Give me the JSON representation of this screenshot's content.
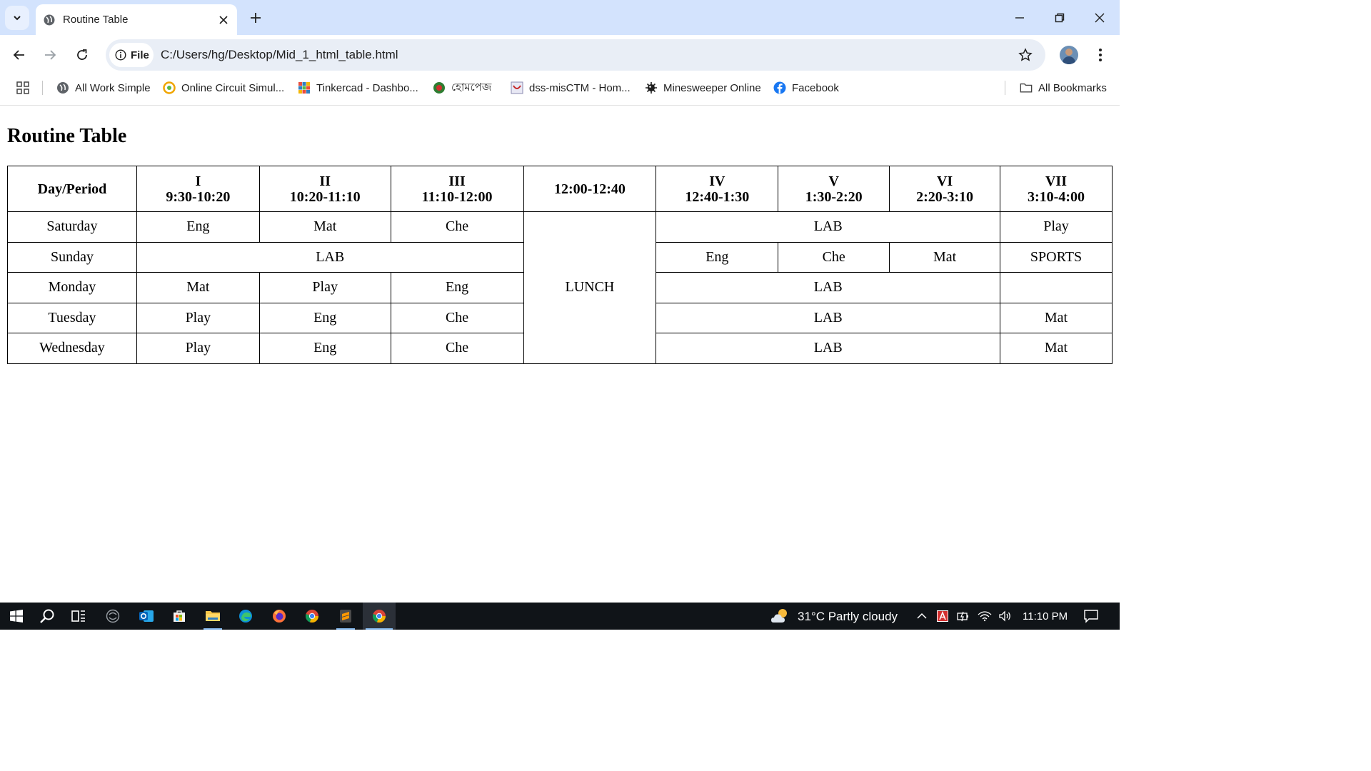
{
  "browser": {
    "tab": {
      "title": "Routine Table"
    },
    "site_chip": "File",
    "url": "C:/Users/hg/Desktop/Mid_1_html_table.html",
    "bookmarks": [
      {
        "label": "All Work Simple",
        "icon": "globe-icon"
      },
      {
        "label": "Online Circuit Simul...",
        "icon": "circuit-icon"
      },
      {
        "label": "Tinkercad - Dashbo...",
        "icon": "tinkercad-icon"
      },
      {
        "label": "হোমপেজ",
        "icon": "bd-emblem-icon"
      },
      {
        "label": "dss-misCTM - Hom...",
        "icon": "dss-icon"
      },
      {
        "label": "Minesweeper Online",
        "icon": "mine-icon"
      },
      {
        "label": "Facebook",
        "icon": "facebook-icon"
      }
    ],
    "all_bookmarks": "All Bookmarks"
  },
  "page": {
    "title": "Routine Table",
    "table": {
      "header": {
        "day_period": "Day/Period",
        "p1": {
          "name": "I",
          "time": "9:30-10:20"
        },
        "p2": {
          "name": "II",
          "time": "10:20-11:10"
        },
        "p3": {
          "name": "III",
          "time": "11:10-12:00"
        },
        "break_time": "12:00-12:40",
        "p4": {
          "name": "IV",
          "time": "12:40-1:30"
        },
        "p5": {
          "name": "V",
          "time": "1:30-2:20"
        },
        "p6": {
          "name": "VI",
          "time": "2:20-3:10"
        },
        "p7": {
          "name": "VII",
          "time": "3:10-4:00"
        }
      },
      "lunch": "LUNCH",
      "saturday": {
        "day": "Saturday",
        "p1": "Eng",
        "p2": "Mat",
        "p3": "Che",
        "p4_6": "LAB",
        "p7": "Play"
      },
      "sunday": {
        "day": "Sunday",
        "p1_3": "LAB",
        "p4": "Eng",
        "p5": "Che",
        "p6": "Mat",
        "p7": "SPORTS"
      },
      "monday": {
        "day": "Monday",
        "p1": "Mat",
        "p2": "Play",
        "p3": "Eng",
        "p4_6": "LAB",
        "p7": ""
      },
      "tuesday": {
        "day": "Tuesday",
        "p1": "Play",
        "p2": "Eng",
        "p3": "Che",
        "p4_6": "LAB",
        "p7": "Mat"
      },
      "wednesday": {
        "day": "Wednesday",
        "p1": "Play",
        "p2": "Eng",
        "p3": "Che",
        "p4_6": "LAB",
        "p7": "Mat"
      }
    }
  },
  "taskbar": {
    "weather": "31°C  Partly cloudy",
    "clock": "11:10 PM",
    "apps": [
      "start-icon",
      "search-icon",
      "task-view-icon",
      "widgets-icon",
      "outlook-icon",
      "store-icon",
      "file-explorer-icon",
      "edge-icon",
      "firefox-icon",
      "chrome-icon",
      "sublime-icon",
      "chrome-active-icon"
    ]
  },
  "colors": {
    "tabstrip": "#d3e3fd",
    "omnibox": "#e9eef6",
    "taskbar": "#101418"
  }
}
